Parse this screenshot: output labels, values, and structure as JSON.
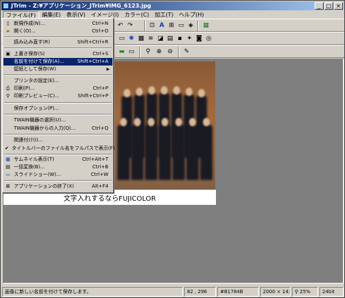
{
  "window": {
    "title": "JTrim - Z:¥アプリケーション_JTrim¥IMG_6123.jpg",
    "minimize": "_",
    "maximize": "□",
    "close": "×"
  },
  "menubar": {
    "items": [
      "ファイル(F)",
      "編集(E)",
      "表示(V)",
      "イメージ(I)",
      "カラー(C)",
      "加工(T)",
      "ヘルプ(H)"
    ]
  },
  "file_menu": {
    "items": [
      {
        "label": "新規作成(N)...",
        "shortcut": "Ctrl+N",
        "icon": "new-icon"
      },
      {
        "label": "開く(O)...",
        "shortcut": "Ctrl+O",
        "icon": "open-icon"
      },
      {
        "label": "読み込み直す(R)",
        "shortcut": "Shift+Ctrl+R",
        "icon": ""
      },
      {
        "label": "上書き保存(S)",
        "shortcut": "Ctrl+S",
        "icon": "save-icon"
      },
      {
        "label": "名前を付けて保存(A)...",
        "shortcut": "Shift+Ctrl+A",
        "icon": ""
      },
      {
        "label": "壁紙として保存(W)",
        "shortcut": "",
        "icon": ""
      },
      {
        "label": "プリンタの設定(E)...",
        "shortcut": "",
        "icon": ""
      },
      {
        "label": "印刷(P)...",
        "shortcut": "Ctrl+P",
        "icon": "print-icon"
      },
      {
        "label": "印刷プレビュー(C)...",
        "shortcut": "Shift+Ctrl+P",
        "icon": "preview-icon"
      },
      {
        "label": "保存オプション(P)...",
        "shortcut": "",
        "icon": ""
      },
      {
        "label": "TWAIN機器の選択(U)...",
        "shortcut": "",
        "icon": ""
      },
      {
        "label": "TWAIN機器からの入力(Q)...",
        "shortcut": "Ctrl+Q",
        "icon": ""
      },
      {
        "label": "関連付け(I)...",
        "shortcut": "",
        "icon": ""
      },
      {
        "label": "タイトルバーのファイル名をフルパスで表示(F)",
        "shortcut": "",
        "icon": "check-icon"
      },
      {
        "label": "サムネイル表示(T)",
        "shortcut": "Ctrl+Alt+T",
        "icon": "thumbnail-icon"
      },
      {
        "label": "一括変換(B)...",
        "shortcut": "Ctrl+B",
        "icon": "batch-icon"
      },
      {
        "label": "スライドショー(W)...",
        "shortcut": "Ctrl+W",
        "icon": "slideshow-icon"
      },
      {
        "label": "アプリケーションの終了(X)",
        "shortcut": "Alt+F4",
        "icon": "exit-icon"
      }
    ]
  },
  "image": {
    "caption": "文字入れするならFUJICOLOR"
  },
  "statusbar": {
    "message": "画像に新しい名前を付けて保存します。",
    "coords": "82 , 296",
    "color": "#B1784B",
    "size": "2000 × 1434",
    "zoom": "25%",
    "depth": "24bit"
  },
  "colors": {
    "titlebar_start": "#0a246a",
    "titlebar_end": "#a6caf0",
    "highlight": "#0a246a",
    "workspace": "#7f7f7f"
  }
}
